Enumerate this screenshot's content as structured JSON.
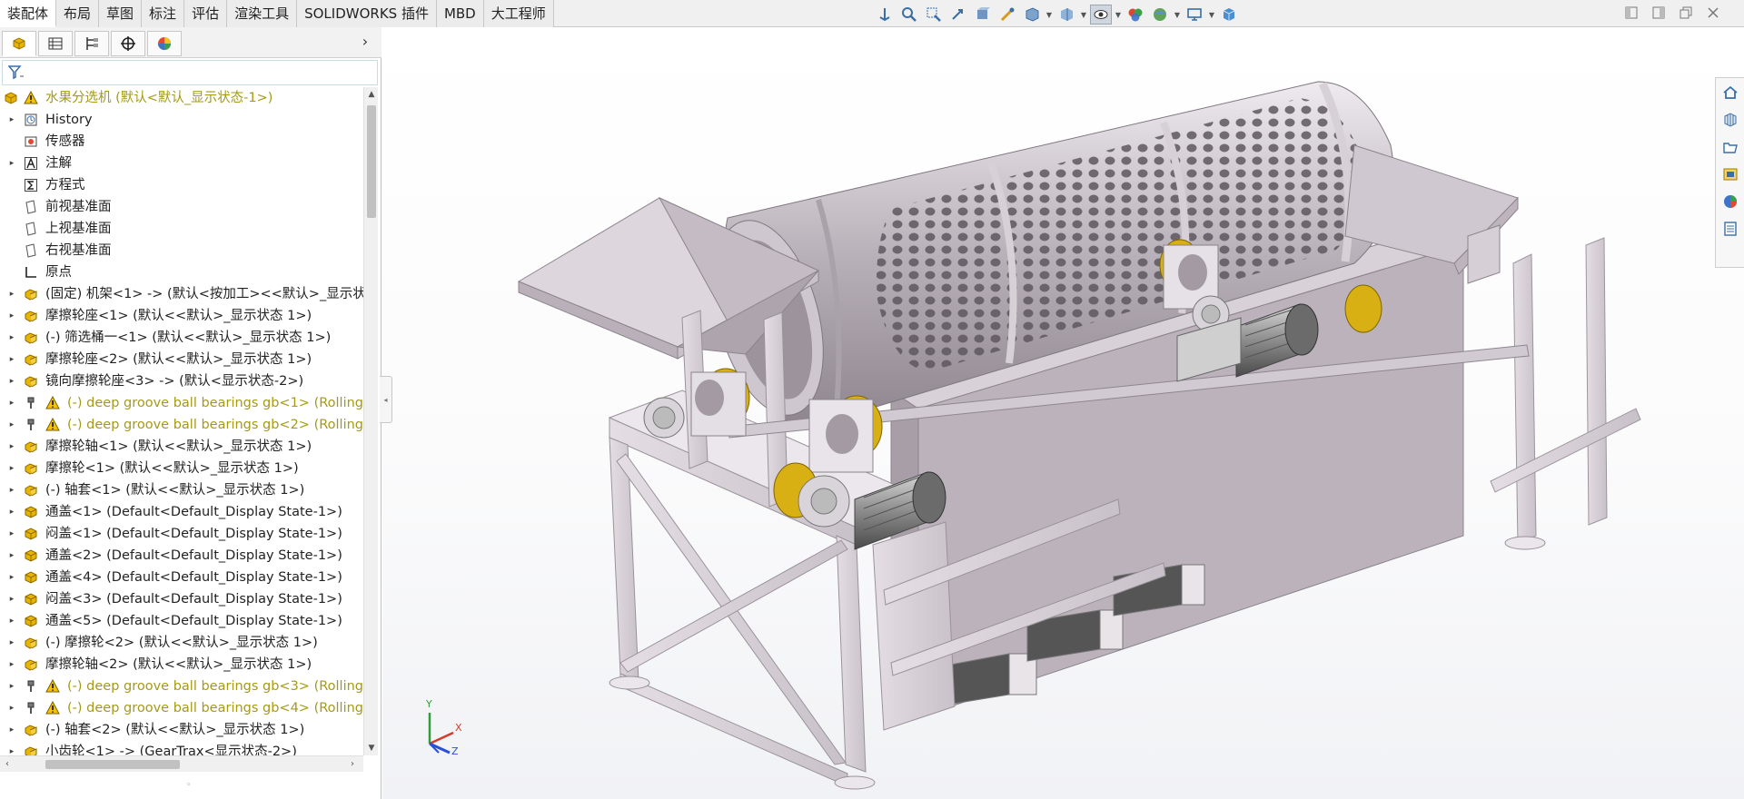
{
  "command_tabs": [
    {
      "label": "装配体",
      "active": true
    },
    {
      "label": "布局",
      "active": false
    },
    {
      "label": "草图",
      "active": false
    },
    {
      "label": "标注",
      "active": false
    },
    {
      "label": "评估",
      "active": false
    },
    {
      "label": "渲染工具",
      "active": false
    },
    {
      "label": "SOLIDWORKS 插件",
      "active": false
    },
    {
      "label": "MBD",
      "active": false
    },
    {
      "label": "大工程师",
      "active": false
    }
  ],
  "view_toolbar": [
    "view-orientation-icon",
    "zoom-to-fit-icon",
    "zoom-to-area-icon",
    "previous-view-icon",
    "section-view-icon",
    "dynamic-annotation-icon",
    "view-orientation-cube-icon",
    "display-style-icon",
    "hide-show-icon",
    "edit-appearance-icon",
    "apply-scene-icon",
    "view-settings-icon",
    "3d-view-icon"
  ],
  "feature_tree": {
    "root": {
      "label": "水果分选机  (默认<默认_显示状态-1>)"
    },
    "rows": [
      {
        "label": "History",
        "icon": "history-icon",
        "expandable": true,
        "warn": false,
        "indent": 1
      },
      {
        "label": "传感器",
        "icon": "sensor-icon",
        "expandable": false,
        "warn": false,
        "indent": 1
      },
      {
        "label": "注解",
        "icon": "annotation-icon",
        "expandable": true,
        "warn": false,
        "indent": 1
      },
      {
        "label": "方程式",
        "icon": "equation-icon",
        "expandable": false,
        "warn": false,
        "indent": 1
      },
      {
        "label": "前视基准面",
        "icon": "plane-icon",
        "expandable": false,
        "warn": false,
        "indent": 1
      },
      {
        "label": "上视基准面",
        "icon": "plane-icon",
        "expandable": false,
        "warn": false,
        "indent": 1
      },
      {
        "label": "右视基准面",
        "icon": "plane-icon",
        "expandable": false,
        "warn": false,
        "indent": 1
      },
      {
        "label": "原点",
        "icon": "origin-icon",
        "expandable": false,
        "warn": false,
        "indent": 1
      },
      {
        "label": "(固定) 机架<1> -> (默认<按加工><<默认>_显示状",
        "icon": "part-icon",
        "expandable": true,
        "warn": false,
        "indent": 1
      },
      {
        "label": "摩擦轮座<1> (默认<<默认>_显示状态 1>)",
        "icon": "part-icon",
        "expandable": true,
        "warn": false,
        "indent": 1
      },
      {
        "label": "(-) 筛选桶一<1> (默认<<默认>_显示状态 1>)",
        "icon": "part-icon",
        "expandable": true,
        "warn": false,
        "indent": 1
      },
      {
        "label": "摩擦轮座<2> (默认<<默认>_显示状态 1>)",
        "icon": "part-icon",
        "expandable": true,
        "warn": false,
        "indent": 1
      },
      {
        "label": "镜向摩擦轮座<3> -> (默认<显示状态-2>)",
        "icon": "part-icon",
        "expandable": true,
        "warn": false,
        "indent": 1
      },
      {
        "label": "(-) deep groove ball bearings gb<1> (Rolling",
        "icon": "toolbox-part-icon",
        "expandable": true,
        "warn": true,
        "indent": 1
      },
      {
        "label": "(-) deep groove ball bearings gb<2> (Rolling",
        "icon": "toolbox-part-icon",
        "expandable": true,
        "warn": true,
        "indent": 1
      },
      {
        "label": "摩擦轮轴<1> (默认<<默认>_显示状态 1>)",
        "icon": "part-icon",
        "expandable": true,
        "warn": false,
        "indent": 1
      },
      {
        "label": "摩擦轮<1> (默认<<默认>_显示状态 1>)",
        "icon": "part-icon",
        "expandable": true,
        "warn": false,
        "indent": 1
      },
      {
        "label": "(-) 轴套<1> (默认<<默认>_显示状态 1>)",
        "icon": "part-icon",
        "expandable": true,
        "warn": false,
        "indent": 1
      },
      {
        "label": "通盖<1> (Default<Default_Display State-1>)",
        "icon": "assembly-part-icon",
        "expandable": true,
        "warn": false,
        "indent": 1
      },
      {
        "label": "闷盖<1> (Default<Default_Display State-1>)",
        "icon": "assembly-part-icon",
        "expandable": true,
        "warn": false,
        "indent": 1
      },
      {
        "label": "通盖<2> (Default<Default_Display State-1>)",
        "icon": "assembly-part-icon",
        "expandable": true,
        "warn": false,
        "indent": 1
      },
      {
        "label": "通盖<4> (Default<Default_Display State-1>)",
        "icon": "assembly-part-icon",
        "expandable": true,
        "warn": false,
        "indent": 1
      },
      {
        "label": "闷盖<3> (Default<Default_Display State-1>)",
        "icon": "assembly-part-icon",
        "expandable": true,
        "warn": false,
        "indent": 1
      },
      {
        "label": "通盖<5> (Default<Default_Display State-1>)",
        "icon": "assembly-part-icon",
        "expandable": true,
        "warn": false,
        "indent": 1
      },
      {
        "label": "(-) 摩擦轮<2> (默认<<默认>_显示状态 1>)",
        "icon": "part-icon",
        "expandable": true,
        "warn": false,
        "indent": 1
      },
      {
        "label": "摩擦轮轴<2> (默认<<默认>_显示状态 1>)",
        "icon": "part-icon",
        "expandable": true,
        "warn": false,
        "indent": 1
      },
      {
        "label": "(-) deep groove ball bearings gb<3> (Rolling",
        "icon": "toolbox-part-icon",
        "expandable": true,
        "warn": true,
        "indent": 1
      },
      {
        "label": "(-) deep groove ball bearings gb<4> (Rolling",
        "icon": "toolbox-part-icon",
        "expandable": true,
        "warn": true,
        "indent": 1
      },
      {
        "label": "(-) 轴套<2> (默认<<默认>_显示状态 1>)",
        "icon": "part-icon",
        "expandable": true,
        "warn": false,
        "indent": 1
      },
      {
        "label": "小齿轮<1> -> (GearTrax<显示状态-2>)",
        "icon": "part-icon",
        "expandable": true,
        "warn": false,
        "indent": 1
      }
    ]
  },
  "triad": {
    "x": "X",
    "y": "Y",
    "z": "Z"
  },
  "colors": {
    "warn_text": "#a49a16",
    "part_yellow": "#e8b400",
    "model_body": "#c8bec8"
  }
}
